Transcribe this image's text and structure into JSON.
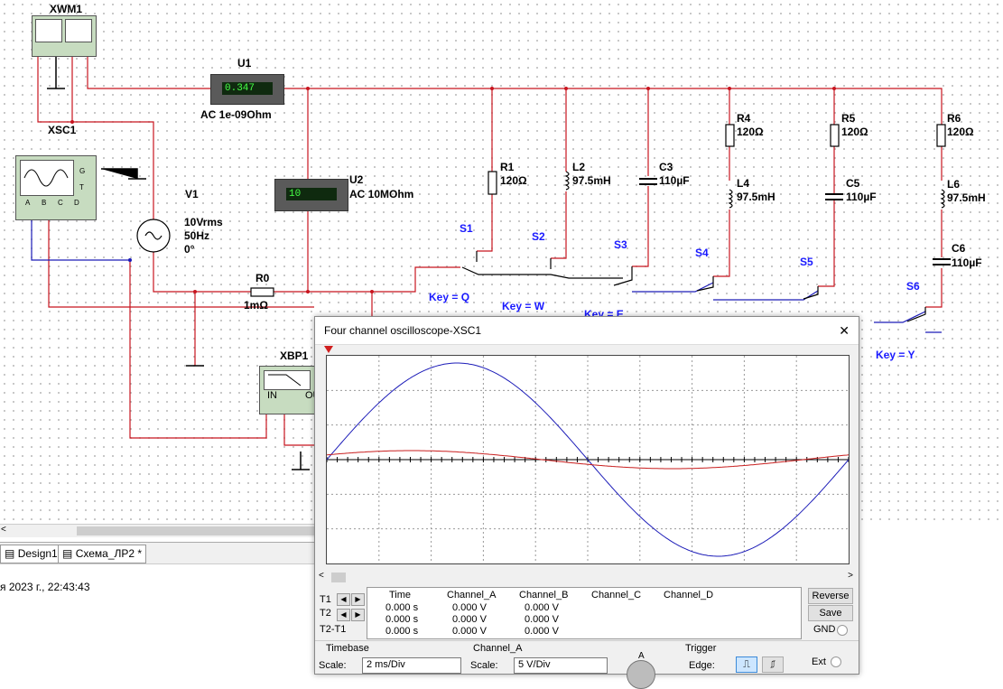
{
  "schematic": {
    "wattmeter": {
      "name": "XWM1"
    },
    "scope": {
      "name": "XSC1",
      "pins": [
        "A",
        "B",
        "C",
        "D"
      ],
      "side_pins": [
        "G",
        "T"
      ]
    },
    "ammeter": {
      "name": "U1",
      "value": "0.347",
      "label": "AC  1e-09Ohm"
    },
    "voltmeter": {
      "name": "U2",
      "value": "10",
      "label": "AC  10MOhm"
    },
    "source": {
      "name": "V1",
      "line1": "10Vrms",
      "line2": "50Hz",
      "line3": "0°"
    },
    "r0": {
      "name": "R0",
      "value": "1mΩ"
    },
    "bode": {
      "name": "XBP1",
      "in_label": "IN",
      "out_label": "OU"
    },
    "components": [
      {
        "name": "R1",
        "value": "120Ω"
      },
      {
        "name": "L2",
        "value": "97.5mH"
      },
      {
        "name": "C3",
        "value": "110µF"
      },
      {
        "name": "R4",
        "value": "120Ω"
      },
      {
        "name": "L4",
        "value": "97.5mH"
      },
      {
        "name": "R5",
        "value": "120Ω"
      },
      {
        "name": "C5",
        "value": "110µF"
      },
      {
        "name": "R6",
        "value": "120Ω"
      },
      {
        "name": "L6",
        "value": "97.5mH"
      },
      {
        "name": "C6",
        "value": "110µF"
      }
    ],
    "switches": [
      {
        "name": "S1",
        "key": "Key = Q"
      },
      {
        "name": "S2",
        "key": "Key = W"
      },
      {
        "name": "S3",
        "key": "Key = E"
      },
      {
        "name": "S4",
        "key": ""
      },
      {
        "name": "S5",
        "key": ""
      },
      {
        "name": "S6",
        "key": "Key = Y"
      }
    ]
  },
  "tabs": [
    {
      "label": "Design1"
    },
    {
      "label": "Схема_ЛР2 *"
    }
  ],
  "status": {
    "timestamp": "я 2023 г., 22:43:43"
  },
  "oscilloscope": {
    "title": "Four channel oscilloscope-XSC1",
    "close": "✕",
    "trace_colors": {
      "channel_a": "#1c1cb8",
      "channel_b": "#c81e1e"
    },
    "readout": {
      "headers": [
        "Time",
        "Channel_A",
        "Channel_B",
        "Channel_C",
        "Channel_D"
      ],
      "rows": [
        {
          "label": "T1",
          "time": "0.000 s",
          "a": "0.000 V",
          "b": "0.000 V"
        },
        {
          "label": "T2",
          "time": "0.000 s",
          "a": "0.000 V",
          "b": "0.000 V"
        },
        {
          "label": "T2-T1",
          "time": "0.000 s",
          "a": "0.000 V",
          "b": "0.000 V"
        }
      ]
    },
    "buttons": {
      "reverse": "Reverse",
      "save": "Save",
      "gnd": "GND"
    },
    "timebase": {
      "section": "Timebase",
      "scale_label": "Scale:",
      "scale": "2 ms/Div"
    },
    "channel": {
      "section": "Channel_A",
      "scale_label": "Scale:",
      "scale": "5  V/Div",
      "knob": "A"
    },
    "trigger": {
      "section": "Trigger",
      "edge_label": "Edge:",
      "ext": "Ext"
    }
  }
}
